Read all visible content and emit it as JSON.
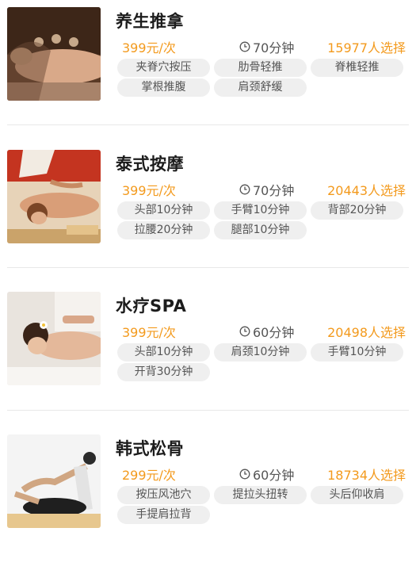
{
  "services": [
    {
      "title": "养生推拿",
      "price": "399元/次",
      "duration": "70分钟",
      "count": "15977人选择",
      "tags": [
        "夹脊穴按压",
        "肋骨轻推",
        "脊椎轻推",
        "掌根推腹",
        "肩颈舒缓"
      ]
    },
    {
      "title": "泰式按摩",
      "price": "399元/次",
      "duration": "70分钟",
      "count": "20443人选择",
      "tags": [
        "头部10分钟",
        "手臂10分钟",
        "背部20分钟",
        "拉腰20分钟",
        "腿部10分钟"
      ]
    },
    {
      "title": "水疗SPA",
      "price": "399元/次",
      "duration": "60分钟",
      "count": "20498人选择",
      "tags": [
        "头部10分钟",
        "肩颈10分钟",
        "手臂10分钟",
        "开背30分钟"
      ]
    },
    {
      "title": "韩式松骨",
      "price": "299元/次",
      "duration": "60分钟",
      "count": "18734人选择",
      "tags": [
        "按压风池穴",
        "提拉头扭转",
        "头后仰收肩",
        "手提肩拉背"
      ]
    }
  ],
  "icons": {
    "duration": "clock-icon"
  },
  "colors": {
    "accent": "#f39a1d",
    "tag_bg": "#efefef"
  }
}
